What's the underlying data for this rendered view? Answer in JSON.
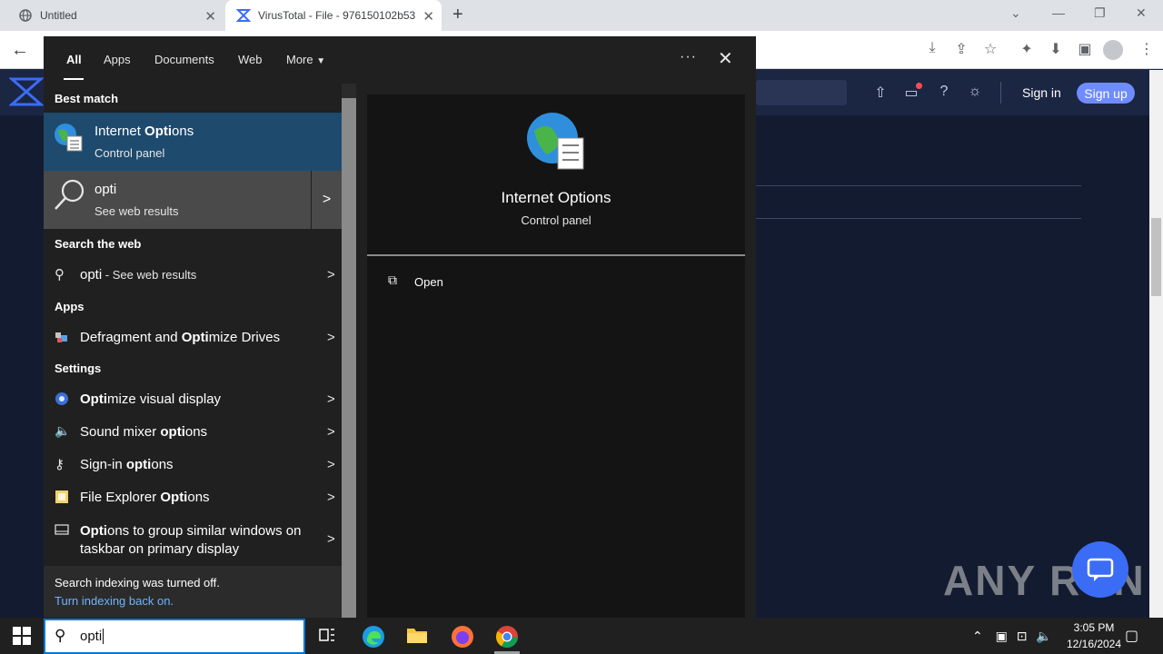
{
  "browser": {
    "tabs": [
      {
        "title": "Untitled",
        "icon": "globe-icon"
      },
      {
        "title": "VirusTotal - File - 976150102b53",
        "icon": "virustotal-icon"
      }
    ]
  },
  "vt": {
    "sign_in": "Sign in",
    "sign_up": "Sign up"
  },
  "search": {
    "filters": [
      "All",
      "Apps",
      "Documents",
      "Web",
      "More"
    ],
    "best_match_label": "Best match",
    "best_match": {
      "title_pre": "Internet ",
      "title_bold": "Opti",
      "title_post": "ons",
      "subtitle": "Control panel"
    },
    "web_result": {
      "title": "opti",
      "subtitle": "See web results"
    },
    "search_web_label": "Search the web",
    "search_web_item": {
      "term": "opti",
      "suffix": " - See web results"
    },
    "apps_label": "Apps",
    "apps": [
      {
        "pre": "Defragment and ",
        "bold": "Opti",
        "post": "mize Drives"
      }
    ],
    "settings_label": "Settings",
    "settings": [
      {
        "pre": "",
        "bold": "Opti",
        "post": "mize visual display"
      },
      {
        "pre": "Sound mixer ",
        "bold": "opti",
        "post": "ons"
      },
      {
        "pre": "Sign-in ",
        "bold": "opti",
        "post": "ons"
      },
      {
        "pre": "File Explorer ",
        "bold": "Opti",
        "post": "ons"
      },
      {
        "pre": "",
        "bold": "Opti",
        "post": "ons to group similar windows on",
        "line2": "taskbar on primary display"
      }
    ],
    "index_notice": "Search indexing was turned off.",
    "index_link": "Turn indexing back on.",
    "preview": {
      "title": "Internet Options",
      "subtitle": "Control panel",
      "action": "Open"
    },
    "query": "opti"
  },
  "taskbar": {
    "time": "3:05 PM",
    "date": "12/16/2024"
  },
  "watermark": "ANY RUN"
}
